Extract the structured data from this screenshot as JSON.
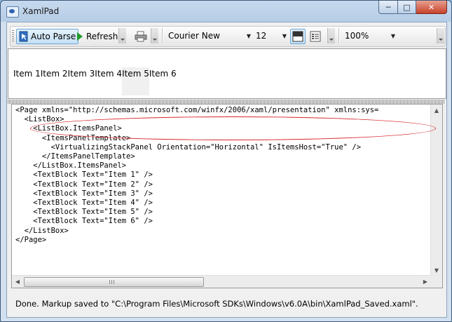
{
  "window": {
    "title": "XamlPad"
  },
  "window_controls": {
    "minimize": "─",
    "maximize": "□",
    "close": "✕"
  },
  "toolbar": {
    "auto_parse_label": "Auto Parse",
    "refresh_label": "Refresh",
    "font_family": "Courier New",
    "font_size": "12",
    "zoom": "100%"
  },
  "preview": {
    "items": [
      "Item 1",
      "Item 2",
      "Item 3",
      "Item 4",
      "Item 5",
      "Item 6"
    ],
    "highlighted_index": 4
  },
  "editor": {
    "lines": [
      "<Page xmlns=\"http://schemas.microsoft.com/winfx/2006/xaml/presentation\" xmlns:sys=",
      "  <ListBox>",
      "    <ListBox.ItemsPanel>",
      "      <ItemsPanelTemplate>",
      "        <VirtualizingStackPanel Orientation=\"Horizontal\" IsItemsHost=\"True\" />",
      "      </ItemsPanelTemplate>",
      "    </ListBox.ItemsPanel>",
      "    <TextBlock Text=\"Item 1\" />",
      "    <TextBlock Text=\"Item 2\" />",
      "    <TextBlock Text=\"Item 3\" />",
      "    <TextBlock Text=\"Item 4\" />",
      "    <TextBlock Text=\"Item 5\" />",
      "    <TextBlock Text=\"Item 6\" />",
      "  </ListBox>",
      "</Page>"
    ]
  },
  "status": {
    "text": "Done. Markup saved to \"C:\\Program Files\\Microsoft SDKs\\Windows\\v6.0A\\bin\\XamlPad_Saved.xaml\"."
  },
  "colors": {
    "annotation": "#d8282a",
    "accent": "#6aa8d8"
  }
}
